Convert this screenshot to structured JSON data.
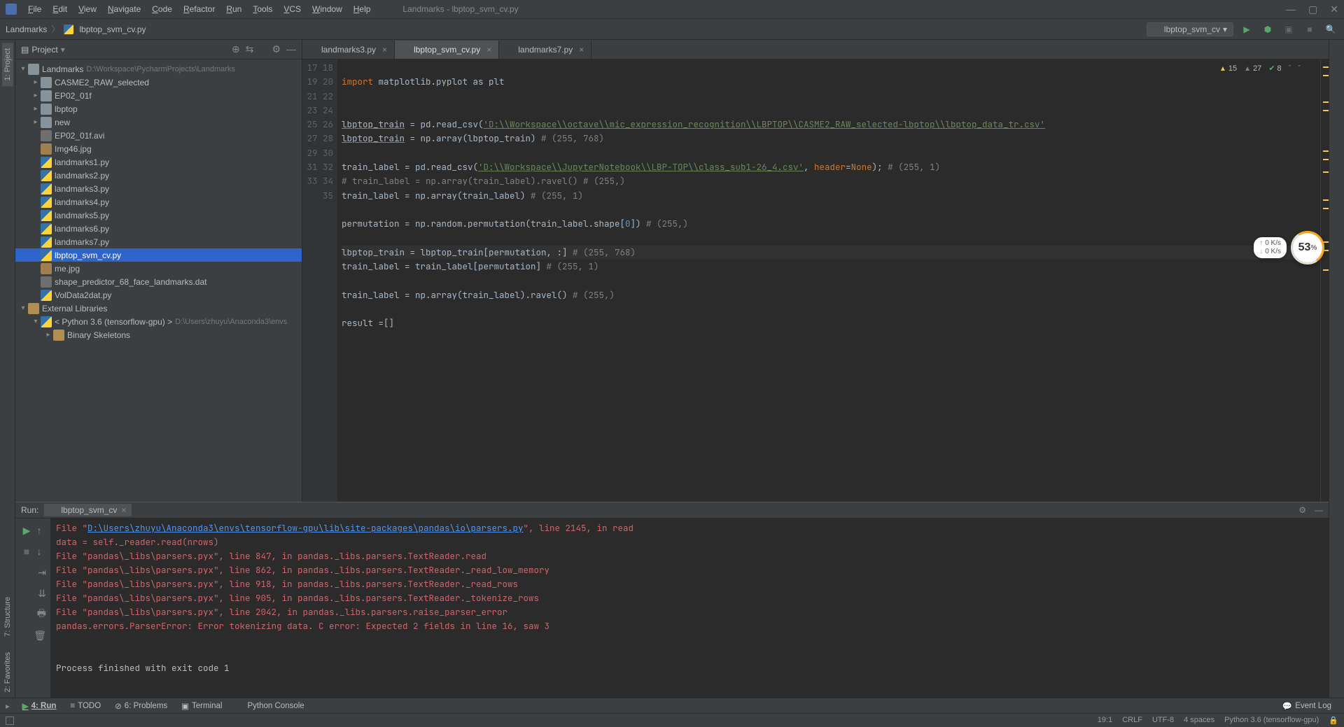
{
  "window": {
    "title": "Landmarks - lbptop_svm_cv.py"
  },
  "menu": [
    "File",
    "Edit",
    "View",
    "Navigate",
    "Code",
    "Refactor",
    "Run",
    "Tools",
    "VCS",
    "Window",
    "Help"
  ],
  "breadcrumb": {
    "root": "Landmarks",
    "file": "lbptop_svm_cv.py"
  },
  "runConfig": "lbptop_svm_cv",
  "projectPanel": {
    "title": "Project"
  },
  "tree": {
    "root": {
      "name": "Landmarks",
      "path": "D:\\Workspace\\PycharmProjects\\Landmarks"
    },
    "folders": [
      "CASME2_RAW_selected",
      "EP02_01f",
      "lbptop",
      "new"
    ],
    "files": [
      {
        "n": "EP02_01f.avi",
        "t": "file"
      },
      {
        "n": "Img46.jpg",
        "t": "img"
      },
      {
        "n": "landmarks1.py",
        "t": "py"
      },
      {
        "n": "landmarks2.py",
        "t": "py"
      },
      {
        "n": "landmarks3.py",
        "t": "py"
      },
      {
        "n": "landmarks4.py",
        "t": "py"
      },
      {
        "n": "landmarks5.py",
        "t": "py"
      },
      {
        "n": "landmarks6.py",
        "t": "py"
      },
      {
        "n": "landmarks7.py",
        "t": "py"
      },
      {
        "n": "lbptop_svm_cv.py",
        "t": "py",
        "sel": true
      },
      {
        "n": "me.jpg",
        "t": "img"
      },
      {
        "n": "shape_predictor_68_face_landmarks.dat",
        "t": "file"
      },
      {
        "n": "VolData2dat.py",
        "t": "py"
      }
    ],
    "extLib": "External Libraries",
    "pyEnv": "< Python 3.6 (tensorflow-gpu) >",
    "pyEnvPath": "D:\\Users\\zhuyu\\Anaconda3\\envs",
    "binSkel": "Binary Skeletons"
  },
  "tabs": [
    {
      "n": "landmarks3.py"
    },
    {
      "n": "lbptop_svm_cv.py",
      "active": true
    },
    {
      "n": "landmarks7.py"
    }
  ],
  "inspections": {
    "warn1": "15",
    "warn2": "27",
    "ok": "8"
  },
  "code": {
    "startLine": 17,
    "lines": [
      "",
      "import matplotlib.pyplot as plt",
      "",
      "",
      "lbptop_train = pd.read_csv('D:\\\\Workspace\\\\octave\\\\mic_expression_recognition\\\\LBPTOP\\\\CASME2_RAW_selected-lbptop\\\\lbptop_data_tr.csv'",
      "lbptop_train = np.array(lbptop_train) # (255, 768)",
      "",
      "train_label = pd.read_csv('D:\\\\Workspace\\\\JupyterNotebook\\\\LBP-TOP\\\\class_sub1-26_4.csv', header=None); # (255, 1)",
      "# train_label = np.array(train_label).ravel() # (255,)",
      "train_label = np.array(train_label) # (255, 1)",
      "",
      "permutation = np.random.permutation(train_label.shape[0]) # (255,)",
      "",
      "lbptop_train = lbptop_train[permutation, :] # (255, 768)",
      "train_label = train_label[permutation] # (255, 1)",
      "",
      "train_label = np.array(train_label).ravel() # (255,)",
      "",
      "result =[]"
    ],
    "currentLine": 30
  },
  "runTab": {
    "label": "Run:",
    "name": "lbptop_svm_cv"
  },
  "console": [
    {
      "t": "err",
      "pre": "  File \"",
      "link": "D:\\Users\\zhuyu\\Anaconda3\\envs\\tensorflow-gpu\\lib\\site-packages\\pandas\\io\\parsers.py",
      "post": "\", line 2145, in read"
    },
    {
      "t": "err",
      "txt": "    data = self._reader.read(nrows)"
    },
    {
      "t": "err",
      "txt": "  File \"pandas\\_libs\\parsers.pyx\", line 847, in pandas._libs.parsers.TextReader.read"
    },
    {
      "t": "err",
      "txt": "  File \"pandas\\_libs\\parsers.pyx\", line 862, in pandas._libs.parsers.TextReader._read_low_memory"
    },
    {
      "t": "err",
      "txt": "  File \"pandas\\_libs\\parsers.pyx\", line 918, in pandas._libs.parsers.TextReader._read_rows"
    },
    {
      "t": "err",
      "txt": "  File \"pandas\\_libs\\parsers.pyx\", line 905, in pandas._libs.parsers.TextReader._tokenize_rows"
    },
    {
      "t": "err",
      "txt": "  File \"pandas\\_libs\\parsers.pyx\", line 2042, in pandas._libs.parsers.raise_parser_error"
    },
    {
      "t": "err",
      "txt": "pandas.errors.ParserError: Error tokenizing data. C error: Expected 2 fields in line 16, saw 3"
    },
    {
      "t": "",
      "txt": ""
    },
    {
      "t": "",
      "txt": ""
    },
    {
      "t": "",
      "txt": "Process finished with exit code 1"
    }
  ],
  "bottomTabs": {
    "run": "4: Run",
    "todo": "TODO",
    "problems": "6: Problems",
    "terminal": "Terminal",
    "pyconsole": "Python Console",
    "eventlog": "Event Log"
  },
  "status": {
    "pos": "19:1",
    "eol": "CRLF",
    "enc": "UTF-8",
    "indent": "4 spaces",
    "interp": "Python 3.6 (tensorflow-gpu)"
  },
  "sideTabs": {
    "project": "1: Project",
    "structure": "7: Structure",
    "favorites": "2: Favorites"
  },
  "netBadge": {
    "up": "0  K/s",
    "down": "0  K/s"
  },
  "pctBadge": "53"
}
